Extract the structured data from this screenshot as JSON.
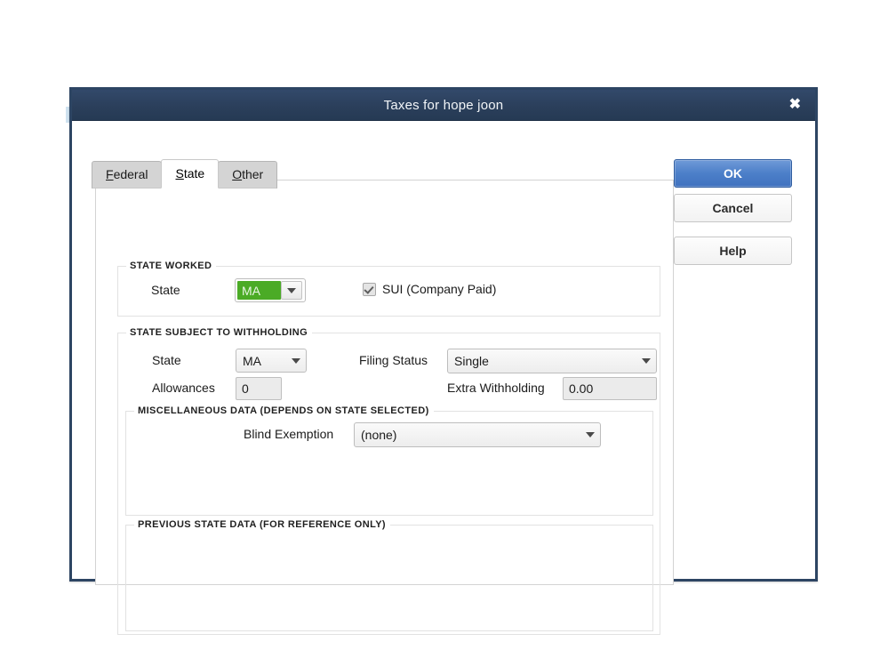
{
  "window": {
    "title": "Taxes for hope joon",
    "close_icon": "close-icon",
    "close_glyph": "✖"
  },
  "tabs": [
    {
      "label_pre": "",
      "label_underlined": "F",
      "label_post": "ederal",
      "full": "Federal",
      "active": false
    },
    {
      "label_pre": "",
      "label_underlined": "S",
      "label_post": "tate",
      "full": "State",
      "active": true
    },
    {
      "label_pre": "",
      "label_underlined": "O",
      "label_post": "ther",
      "full": "Other",
      "active": false
    }
  ],
  "state_worked": {
    "group_title": "STATE WORKED",
    "state_label": "State",
    "state_value": "MA",
    "state_highlight_color": "#4bab26",
    "sui_checkbox_label": "SUI (Company Paid)",
    "sui_checked": true
  },
  "withholding": {
    "group_title": "STATE SUBJECT TO WITHHOLDING",
    "state_label": "State",
    "state_value": "MA",
    "filing_status_label": "Filing Status",
    "filing_status_value": "Single",
    "allowances_label": "Allowances",
    "allowances_value": "0",
    "extra_withholding_label": "Extra Withholding",
    "extra_withholding_value": "0.00"
  },
  "misc": {
    "group_title": "MISCELLANEOUS DATA (DEPENDS ON STATE SELECTED)",
    "blind_exemption_label": "Blind Exemption",
    "blind_exemption_value": "(none)"
  },
  "previous": {
    "group_title": "PREVIOUS STATE DATA (FOR REFERENCE ONLY)",
    "content": ""
  },
  "buttons": {
    "ok": "OK",
    "cancel": "Cancel",
    "help": "Help"
  },
  "colors": {
    "titlebar": "#2b3f5b",
    "dialog_border": "#2d4563",
    "accent_button": "#4072bf",
    "selection_green": "#4bab26"
  }
}
